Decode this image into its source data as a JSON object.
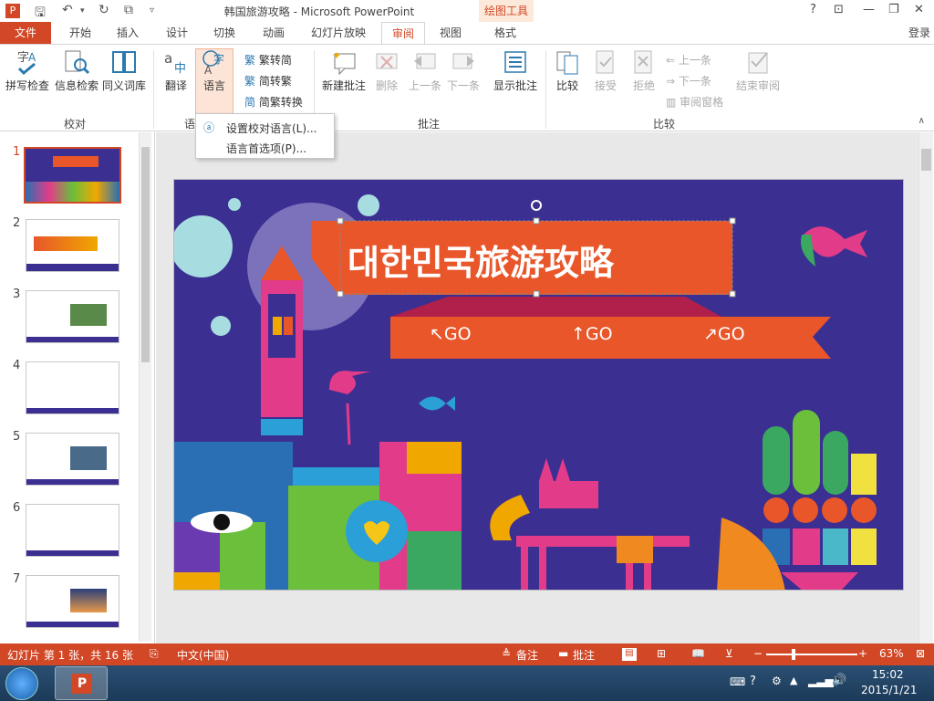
{
  "window": {
    "title": "韩国旅游攻略 - Microsoft PowerPoint",
    "context_tab": "绘图工具"
  },
  "tabs": {
    "file": "文件",
    "items": [
      "开始",
      "插入",
      "设计",
      "切换",
      "动画",
      "幻灯片放映",
      "审阅",
      "视图",
      "格式"
    ],
    "active": "审阅",
    "login": "登录"
  },
  "ribbon": {
    "proofing": {
      "spell": "拼写检查",
      "research": "信息检索",
      "thesaurus": "同义词库",
      "label": "校对"
    },
    "language": {
      "translate": "翻译",
      "language": "语言",
      "label": "语"
    },
    "chinese": {
      "t2s": "繁转简",
      "s2t": "简转繁",
      "convert": "简繁转换"
    },
    "comments": {
      "new": "新建批注",
      "delete": "删除",
      "prev": "上一条",
      "next": "下一条",
      "show": "显示批注",
      "label": "批注"
    },
    "compare": {
      "compare": "比较",
      "accept": "接受",
      "reject": "拒绝",
      "prev": "上一条",
      "next": "下一条",
      "pane": "审阅窗格",
      "end": "结束审阅",
      "label": "比较"
    }
  },
  "dropdown": {
    "items": [
      "设置校对语言(L)...",
      "语言首选项(P)..."
    ]
  },
  "thumbnails": {
    "numbers": [
      "1",
      "2",
      "3",
      "4",
      "5",
      "6",
      "7"
    ],
    "selected": "1"
  },
  "slide": {
    "title": "대한민국旅游攻略",
    "go1": "↖GO",
    "go2": "↑GO",
    "go3": "↗GO"
  },
  "status": {
    "slide_info": "幻灯片 第 1 张，共 16 张",
    "language": "中文(中国)",
    "notes": "备注",
    "comments": "批注",
    "zoom": "63%"
  },
  "taskbar": {
    "time": "15:02",
    "date": "2015/1/21"
  },
  "colors": {
    "accent": "#d24726",
    "slide_bg": "#3b2f91",
    "banner": "#e8562a"
  }
}
